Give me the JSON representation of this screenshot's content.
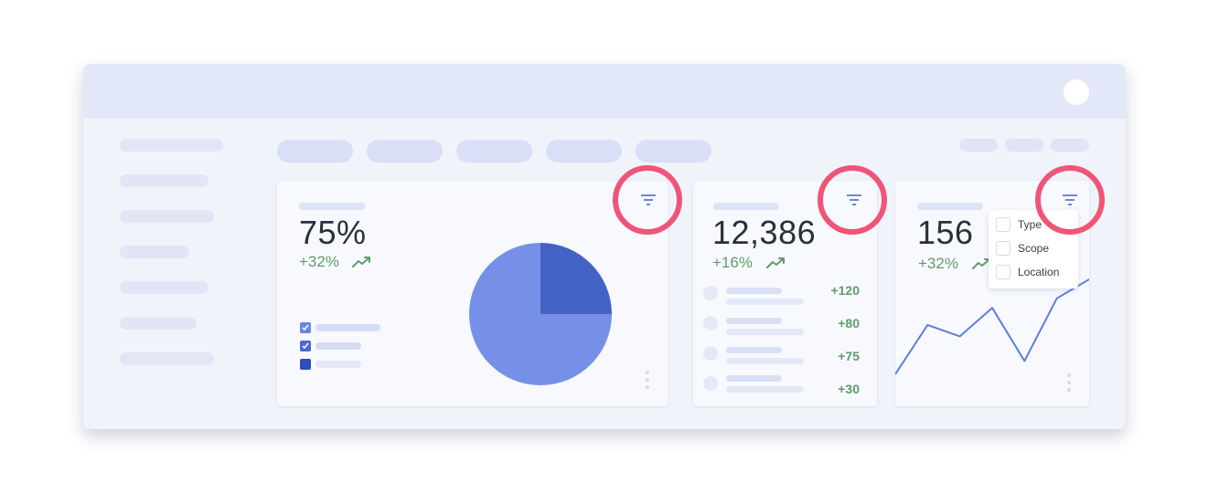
{
  "cards": {
    "percent": {
      "value": "75%",
      "delta": "+32%"
    },
    "count": {
      "value": "12,386",
      "delta": "+16%",
      "rows": [
        "+120",
        "+80",
        "+75",
        "+30"
      ]
    },
    "line": {
      "value": "156",
      "delta": "+32%"
    }
  },
  "filter_menu": {
    "options": [
      "Type",
      "Scope",
      "Location"
    ]
  },
  "icons": {
    "filter": "filter-icon",
    "trend": "trending-up-icon",
    "more": "more-vertical-icon"
  },
  "colors": {
    "highlight": "#ef5577",
    "pie_light": "#7690e8",
    "pie_dark": "#4263c4",
    "positive": "#5f9c6a",
    "line": "#5d7de0"
  },
  "chart_data": [
    {
      "type": "pie",
      "values": [
        75,
        25
      ],
      "colors": [
        "#7690e8",
        "#4263c4"
      ]
    },
    {
      "type": "line",
      "values": [
        0,
        52,
        40,
        70,
        14,
        80,
        100
      ]
    }
  ]
}
